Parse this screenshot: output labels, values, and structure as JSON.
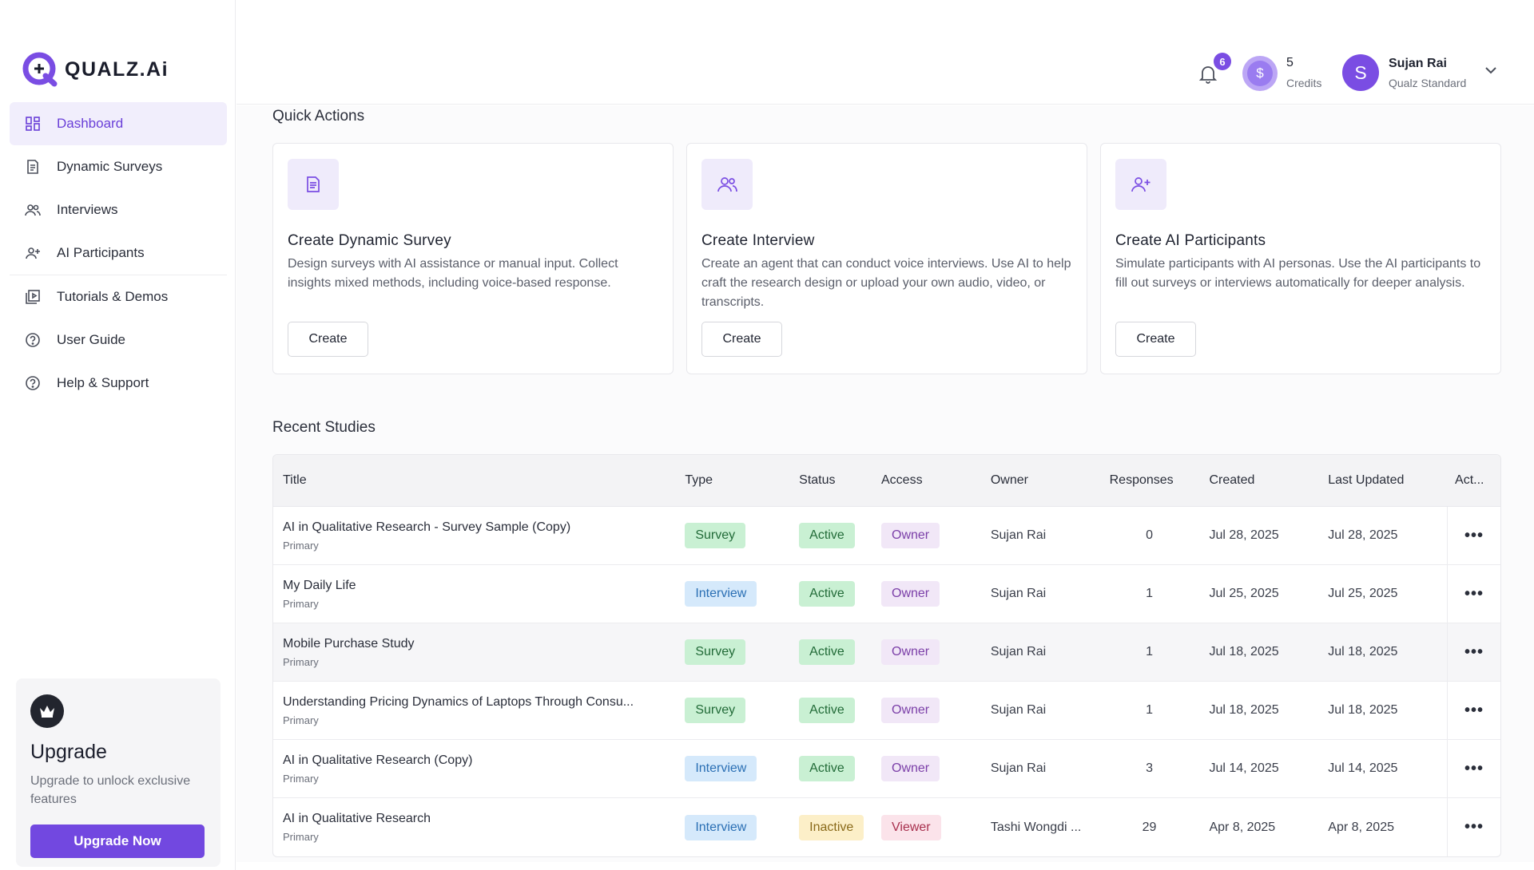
{
  "brand": {
    "name": "QUALZ.Ai"
  },
  "sidebar": {
    "items": [
      {
        "label": "Dashboard",
        "icon": "dashboard-icon",
        "active": true
      },
      {
        "label": "Dynamic Surveys",
        "icon": "document-icon"
      },
      {
        "label": "Interviews",
        "icon": "users-icon"
      },
      {
        "label": "AI Participants",
        "icon": "user-plus-icon"
      },
      {
        "label": "Tutorials & Demos",
        "icon": "video-library-icon"
      },
      {
        "label": "User Guide",
        "icon": "help-circle-icon"
      },
      {
        "label": "Help & Support",
        "icon": "help-circle-icon"
      }
    ],
    "upgrade": {
      "title": "Upgrade",
      "text": "Upgrade to unlock exclusive features",
      "button": "Upgrade Now"
    }
  },
  "header": {
    "notifications_count": "6",
    "credits_value": "5",
    "credits_label": "Credits",
    "credit_symbol": "$",
    "user": {
      "initial": "S",
      "name": "Sujan Rai",
      "plan": "Qualz Standard"
    }
  },
  "quick_actions": {
    "title": "Quick Actions",
    "cards": [
      {
        "title": "Create Dynamic Survey",
        "desc": "Design surveys with AI assistance or manual input. Collect insights mixed methods, including voice-based response.",
        "button": "Create",
        "icon": "document-icon"
      },
      {
        "title": "Create Interview",
        "desc": "Create an agent that can conduct voice interviews. Use AI to help craft the research design or upload your own audio, video, or transcripts.",
        "button": "Create",
        "icon": "users-icon"
      },
      {
        "title": "Create AI Participants",
        "desc": "Simulate participants with AI personas. Use the AI participants to fill out surveys or interviews automatically for deeper analysis.",
        "button": "Create",
        "icon": "user-plus-icon"
      }
    ]
  },
  "recent_studies": {
    "title": "Recent Studies",
    "columns": [
      "Title",
      "Type",
      "Status",
      "Access",
      "Owner",
      "Responses",
      "Created",
      "Last Updated",
      "Act..."
    ],
    "rows": [
      {
        "title": "AI in Qualitative Research - Survey Sample (Copy)",
        "sub": "Primary",
        "type": "Survey",
        "status": "Active",
        "access": "Owner",
        "owner": "Sujan Rai",
        "responses": "0",
        "created": "Jul 28, 2025",
        "updated": "Jul 28, 2025"
      },
      {
        "title": "My Daily Life",
        "sub": "Primary",
        "type": "Interview",
        "status": "Active",
        "access": "Owner",
        "owner": "Sujan Rai",
        "responses": "1",
        "created": "Jul 25, 2025",
        "updated": "Jul 25, 2025"
      },
      {
        "title": "Mobile Purchase Study",
        "sub": "Primary",
        "type": "Survey",
        "status": "Active",
        "access": "Owner",
        "owner": "Sujan Rai",
        "responses": "1",
        "created": "Jul 18, 2025",
        "updated": "Jul 18, 2025"
      },
      {
        "title": "Understanding Pricing Dynamics of Laptops Through Consu...",
        "sub": "Primary",
        "type": "Survey",
        "status": "Active",
        "access": "Owner",
        "owner": "Sujan Rai",
        "responses": "1",
        "created": "Jul 18, 2025",
        "updated": "Jul 18, 2025"
      },
      {
        "title": "AI in Qualitative Research (Copy)",
        "sub": "Primary",
        "type": "Interview",
        "status": "Active",
        "access": "Owner",
        "owner": "Sujan Rai",
        "responses": "3",
        "created": "Jul 14, 2025",
        "updated": "Jul 14, 2025"
      },
      {
        "title": "AI in Qualitative Research",
        "sub": "Primary",
        "type": "Interview",
        "status": "Inactive",
        "access": "Viewer",
        "owner": "Tashi Wongdi ...",
        "responses": "29",
        "created": "Apr 8, 2025",
        "updated": "Apr 8, 2025"
      }
    ],
    "actions_glyph": "•••"
  },
  "colors": {
    "accent": "#7248e0",
    "active_nav_bg": "#f1eefc"
  }
}
